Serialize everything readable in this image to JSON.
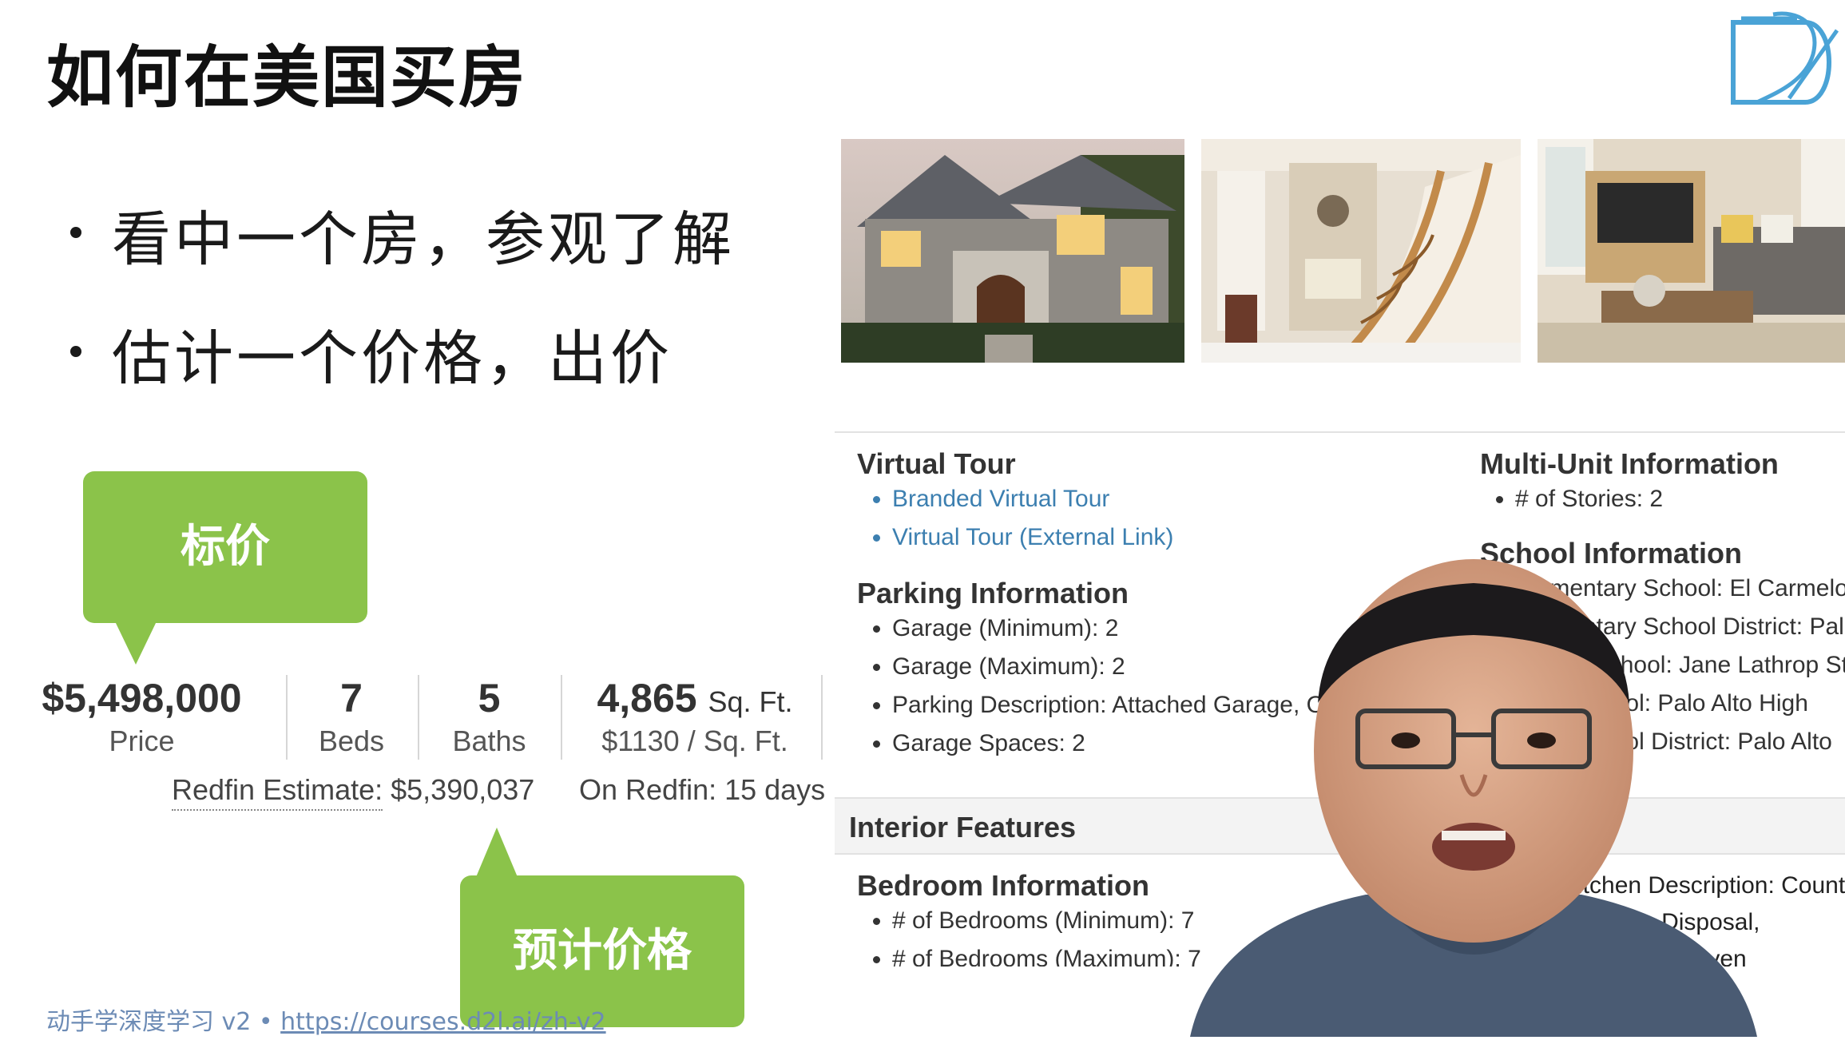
{
  "slide": {
    "title": "如何在美国买房",
    "bullets": [
      "看中一个房，参观了解",
      "估计一个价格，出价"
    ],
    "footer_text": "动手学深度学习 v2 • ",
    "footer_link": "https://courses.d2l.ai/zh-v2"
  },
  "photos": [
    {
      "icon": "house-exterior-photo"
    },
    {
      "icon": "staircase-interior-photo"
    },
    {
      "icon": "living-room-photo"
    }
  ],
  "callouts": {
    "price_label": "标价",
    "estimate_label": "预计价格",
    "color": "#8bc34a"
  },
  "listing": {
    "price": "$5,498,000",
    "price_label": "Price",
    "beds": "7",
    "beds_label": "Beds",
    "baths": "5",
    "baths_label": "Baths",
    "sqft": "4,865",
    "sqft_unit": "Sq. Ft.",
    "price_per_sqft": "$1130 / Sq. Ft.",
    "estimate_label": "Redfin Estimate:",
    "estimate_value": "$5,390,037",
    "on_redfin": "On Redfin: 15 days"
  },
  "details": {
    "virtual_tour": {
      "heading": "Virtual Tour",
      "items": [
        "Branded Virtual Tour",
        "Virtual Tour (External Link)"
      ]
    },
    "parking": {
      "heading": "Parking Information",
      "items": [
        "Garage (Minimum): 2",
        "Garage (Maximum): 2",
        "Parking Description: Attached Garage, On Street",
        "Garage Spaces: 2"
      ]
    },
    "multi_unit": {
      "heading": "Multi-Unit Information",
      "items": [
        "# of Stories: 2"
      ]
    },
    "school": {
      "heading": "School Information",
      "items": [
        "Elementary School: El Carmelo",
        "Elementary School District: Pal",
        "Middle School: Jane Lathrop St",
        "High School: Palo Alto High",
        "High School District: Palo Alto"
      ]
    },
    "interior_heading": "Interior Features",
    "bedroom": {
      "heading": "Bedroom Information",
      "items": [
        "# of Bedrooms (Minimum): 7",
        "# of Bedrooms (Maximum): 7"
      ]
    },
    "kitchen_partial": [
      "Kitchen Description: Countertops",
      "Garbage Disposal,",
      "Microwave, Oven"
    ]
  },
  "colors": {
    "link": "#3c7fb0",
    "footer": "#6c8bb5",
    "logo": "#4aa3d6"
  }
}
